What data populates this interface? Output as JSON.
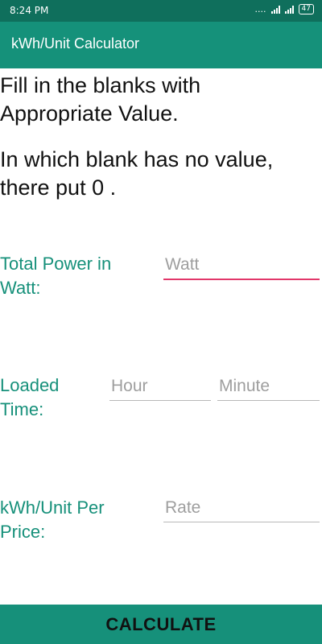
{
  "status_bar": {
    "time": "8:24 PM",
    "dots": "....",
    "battery": "47"
  },
  "app_bar": {
    "title": "kWh/Unit Calculator"
  },
  "instructions": {
    "line1": "Fill in the blanks with Appropriate Value.",
    "line2": "In which blank has no value, there put 0 ."
  },
  "form": {
    "power": {
      "label": "Total Power in Watt:",
      "placeholder": "Watt",
      "value": ""
    },
    "time": {
      "label": "Loaded Time:",
      "hour_placeholder": "Hour",
      "minute_placeholder": "Minute"
    },
    "price": {
      "label": "kWh/Unit Per Price:",
      "placeholder": "Rate"
    }
  },
  "calculate_button": {
    "label": "CALCULATE"
  },
  "colors": {
    "status_bar": "#0f6f5c",
    "app_bar": "#15917a",
    "accent": "#16907a",
    "focus_underline": "#e2376a"
  }
}
